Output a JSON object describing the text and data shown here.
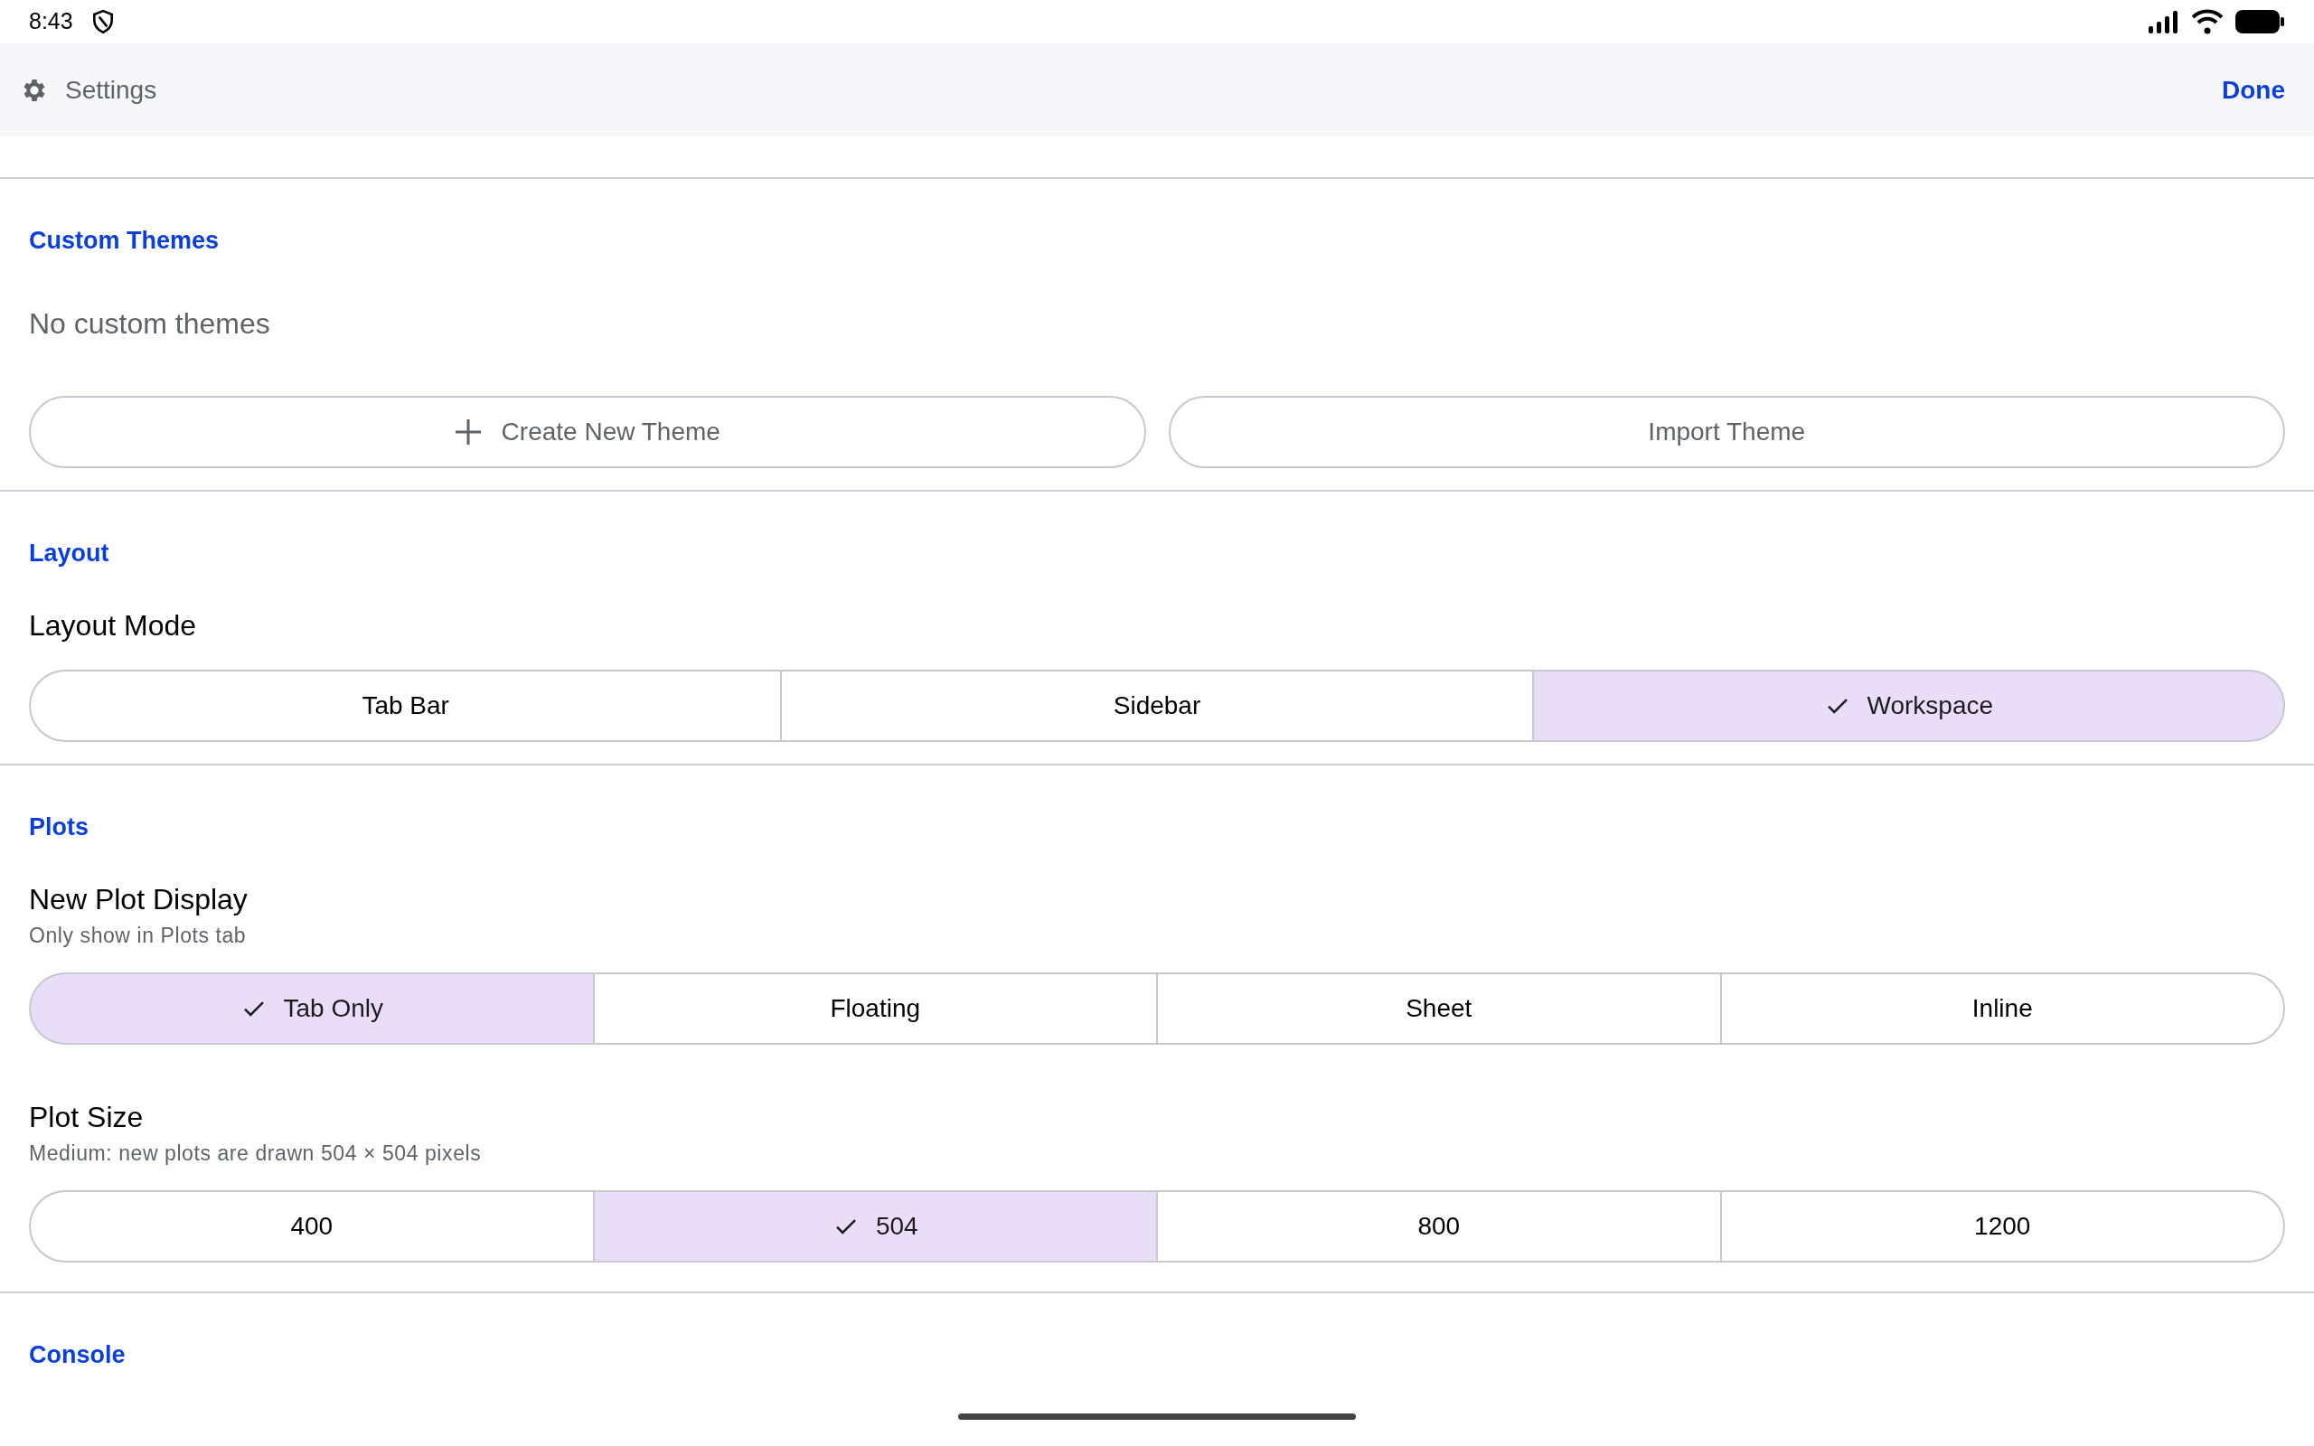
{
  "status_bar": {
    "time": "8:43"
  },
  "header": {
    "title": "Settings",
    "done": "Done"
  },
  "sections": [
    {
      "title": "Custom Themes",
      "kind": "themes",
      "message": "No custom themes",
      "buttons": [
        {
          "label": "Create New Theme"
        },
        {
          "label": "Import Theme"
        }
      ]
    },
    {
      "title": "Layout",
      "kind": "settings",
      "settings": [
        {
          "label": "Layout Mode",
          "options": [
            {
              "label": "Tab Bar",
              "selected": false
            },
            {
              "label": "Sidebar",
              "selected": false
            },
            {
              "label": "Workspace",
              "selected": true
            }
          ]
        }
      ]
    },
    {
      "title": "Plots",
      "kind": "settings",
      "settings": [
        {
          "label": "New Plot Display",
          "subtitle": "Only show in Plots tab",
          "options": [
            {
              "label": "Tab Only",
              "selected": true
            },
            {
              "label": "Floating",
              "selected": false
            },
            {
              "label": "Sheet",
              "selected": false
            },
            {
              "label": "Inline",
              "selected": false
            }
          ]
        },
        {
          "label": "Plot Size",
          "subtitle": "Medium: new plots are drawn 504 × 504 pixels",
          "options": [
            {
              "label": "400",
              "selected": false
            },
            {
              "label": "504",
              "selected": true
            },
            {
              "label": "800",
              "selected": false
            },
            {
              "label": "1200",
              "selected": false
            }
          ]
        }
      ]
    },
    {
      "title": "Console",
      "kind": "title"
    }
  ]
}
